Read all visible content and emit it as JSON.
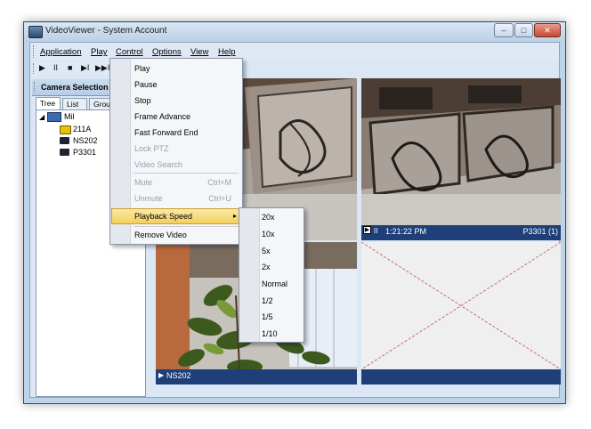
{
  "window": {
    "title": "VideoViewer - System Account",
    "caption_buttons": {
      "minimize": "–",
      "maximize": "□",
      "close": "✕"
    }
  },
  "menubar": [
    "Application",
    "Play",
    "Control",
    "Options",
    "View",
    "Help"
  ],
  "toolbar": {
    "play": "▶",
    "pause": "II",
    "stop": "■",
    "frame_advance": "▶I",
    "fast_forward_end": "▶▶I"
  },
  "camera_panel": {
    "title": "Camera Selection",
    "tabs": [
      "Tree",
      "List",
      "Group"
    ],
    "root": "Mil",
    "cameras": [
      "211A",
      "NS202",
      "P3301"
    ]
  },
  "panes": {
    "top_right": {
      "play_icon": "▶",
      "pause_icon": "II",
      "timestamp": "1:21:22 PM",
      "camera": "P3301 (1)",
      "progress": 0.07
    },
    "bottom_left": {
      "play_icon": "▶",
      "camera": "NS202"
    }
  },
  "control_menu": {
    "items": [
      {
        "label": "Play",
        "shortcut": "",
        "disabled": false
      },
      {
        "label": "Pause",
        "shortcut": "",
        "disabled": false
      },
      {
        "label": "Stop",
        "shortcut": "",
        "disabled": false
      },
      {
        "label": "Frame Advance",
        "shortcut": "",
        "disabled": false
      },
      {
        "label": "Fast Forward End",
        "shortcut": "",
        "disabled": false
      },
      {
        "label": "Lock PTZ",
        "shortcut": "",
        "disabled": true
      },
      {
        "label": "Video Search",
        "shortcut": "",
        "disabled": true
      },
      {
        "label": "Mute",
        "shortcut": "Ctrl+M",
        "disabled": true
      },
      {
        "label": "Unmute",
        "shortcut": "Ctrl+U",
        "disabled": true
      },
      {
        "label": "Playback Speed",
        "shortcut": "",
        "disabled": false
      },
      {
        "label": "Remove Video",
        "shortcut": "",
        "disabled": false
      }
    ],
    "submenu_arrow": "▸"
  },
  "speed_menu": [
    "20x",
    "10x",
    "5x",
    "2x",
    "Normal",
    "1/2",
    "1/5",
    "1/10"
  ],
  "colors": {
    "accent": "#1e3f78",
    "highlight": "#f3cf5c",
    "frame": "#bcd3ea"
  }
}
